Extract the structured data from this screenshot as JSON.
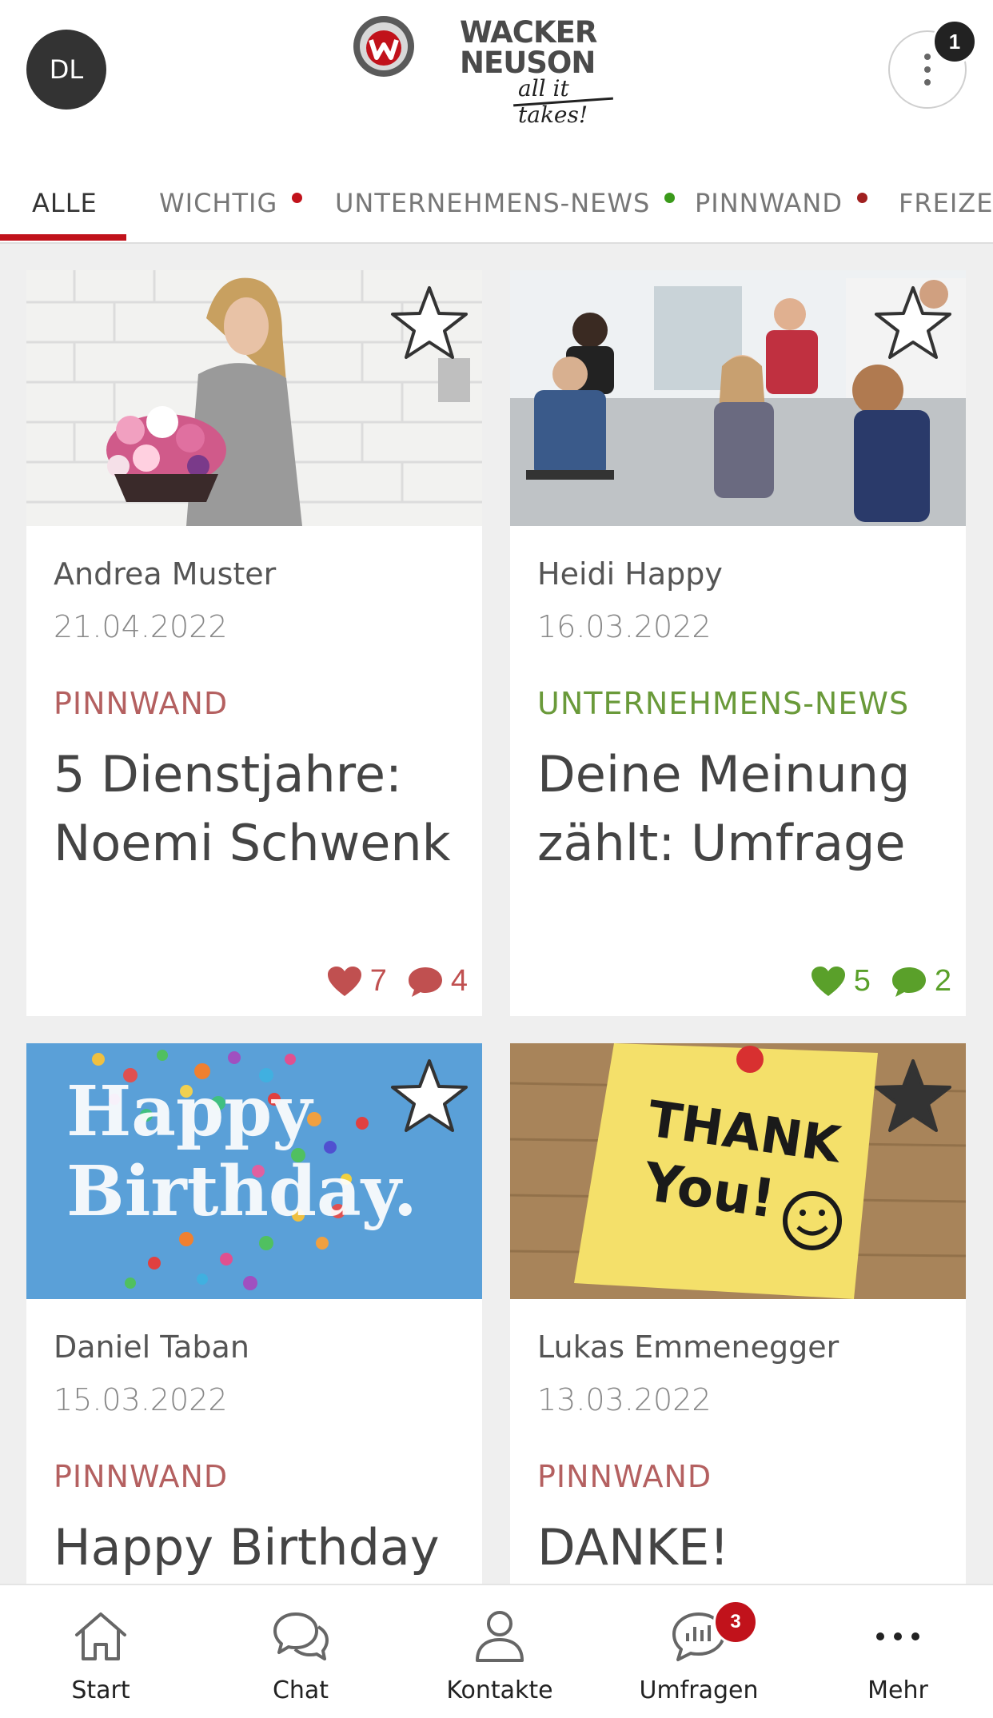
{
  "header": {
    "avatar_initials": "DL",
    "logo_line1": "WACKER",
    "logo_line2": "NEUSON",
    "logo_tagline": "all it takes!",
    "notification_count": "1"
  },
  "tabs": [
    {
      "label": "ALLE",
      "active": true,
      "dot_color": null
    },
    {
      "label": "WICHTIG",
      "active": false,
      "dot_color": "#c1121b"
    },
    {
      "label": "UNTERNEHMENS-NEWS",
      "active": false,
      "dot_color": "#3a9a1a"
    },
    {
      "label": "PINNWAND",
      "active": false,
      "dot_color": "#a02020"
    },
    {
      "label": "FREIZEI",
      "active": false,
      "dot_color": null
    }
  ],
  "cards": [
    {
      "author": "Andrea Muster",
      "date": "21.04.2022",
      "category": "PINNWAND",
      "title": "5 Dienstjahre: Noemi Schwenk",
      "likes": "7",
      "comments": "4",
      "starred": false,
      "image": "woman-with-flowers-photo"
    },
    {
      "author": "Heidi Happy",
      "date": "16.03.2022",
      "category": "UNTERNEHMENS-NEWS",
      "title": "Deine Meinung zählt: Umfrage",
      "likes": "5",
      "comments": "2",
      "starred": false,
      "image": "office-meeting-photo"
    },
    {
      "author": "Daniel Taban",
      "date": "15.03.2022",
      "category": "PINNWAND",
      "title": "Happy Birthday",
      "image_text_line1": "Happy",
      "image_text_line2": "Birthday.",
      "starred": false,
      "image": "birthday-confetti-image"
    },
    {
      "author": "Lukas Emmenegger",
      "date": "13.03.2022",
      "category": "PINNWAND",
      "title": "DANKE!",
      "image_text_line1": "THANK",
      "image_text_line2": "You!",
      "starred": true,
      "image": "thank-you-sticky-note-image"
    }
  ],
  "colors": {
    "accent_red": "#c1121b",
    "category_red": "#b46060",
    "category_green": "#6a9a3a",
    "stat_red": "#c05050",
    "stat_green": "#5aa02a"
  },
  "bottom_nav": [
    {
      "label": "Start",
      "icon": "home-icon"
    },
    {
      "label": "Chat",
      "icon": "chat-icon"
    },
    {
      "label": "Kontakte",
      "icon": "person-icon"
    },
    {
      "label": "Umfragen",
      "icon": "poll-icon",
      "badge": "3"
    },
    {
      "label": "Mehr",
      "icon": "more-dots-icon"
    }
  ]
}
